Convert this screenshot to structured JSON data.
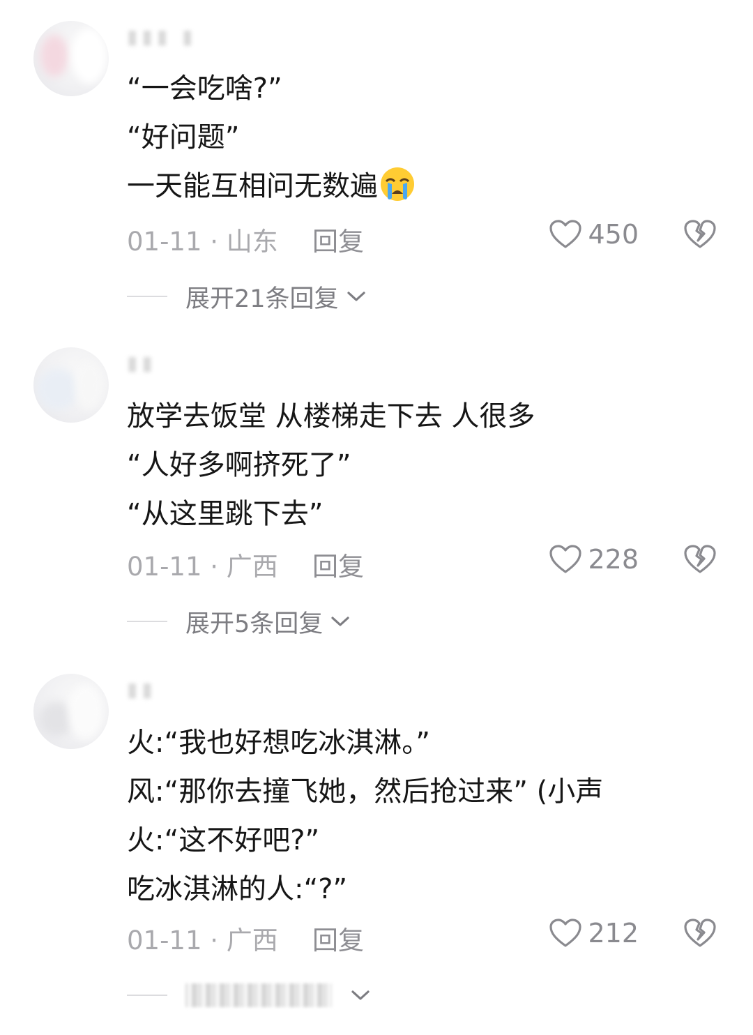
{
  "colors": {
    "body_text": "#161616",
    "meta_text": "#a9a9ad",
    "reply_text": "#8e8e93",
    "icon_gray": "#8a8a8f"
  },
  "comments": [
    {
      "lines": [
        "“一会吃啥?”",
        "“好问题”",
        "一天能互相问无数遍"
      ],
      "emoji_icon": "loudly-crying-face-icon",
      "date_location": "01-11 · 山东",
      "reply_label": "回复",
      "likes": "450",
      "expand_label": "展开21条回复"
    },
    {
      "lines": [
        "放学去饭堂 从楼梯走下去 人很多",
        "“人好多啊挤死了”",
        "“从这里跳下去”"
      ],
      "date_location": "01-11 · 广西",
      "reply_label": "回复",
      "likes": "228",
      "expand_label": "展开5条回复"
    },
    {
      "lines": [
        "火:“我也好想吃冰淇淋。”",
        "风:“那你去撞飞她，然后抢过来” (小声",
        "火:“这不好吧?”",
        "吃冰淇淋的人:“?”"
      ],
      "date_location": "01-11 · 广西",
      "reply_label": "回复",
      "likes": "212",
      "expand_label": ""
    }
  ]
}
